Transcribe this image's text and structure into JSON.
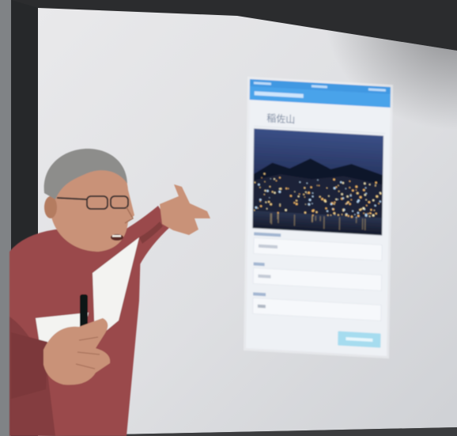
{
  "screen": {
    "phone": {
      "title": "稲佐山"
    }
  },
  "colors": {
    "wall": "#6f7275",
    "screen_frame": "#26282a",
    "phone_header": "#4aa3ea",
    "phone_body": "#eef1f5",
    "phone_button": "#a6dcef",
    "sweater": "#9a4a4c",
    "sweater_shadow": "#7b383b",
    "skin": "#c99278",
    "hair": "#8d8d8b",
    "paper": "#f3f3f1"
  }
}
